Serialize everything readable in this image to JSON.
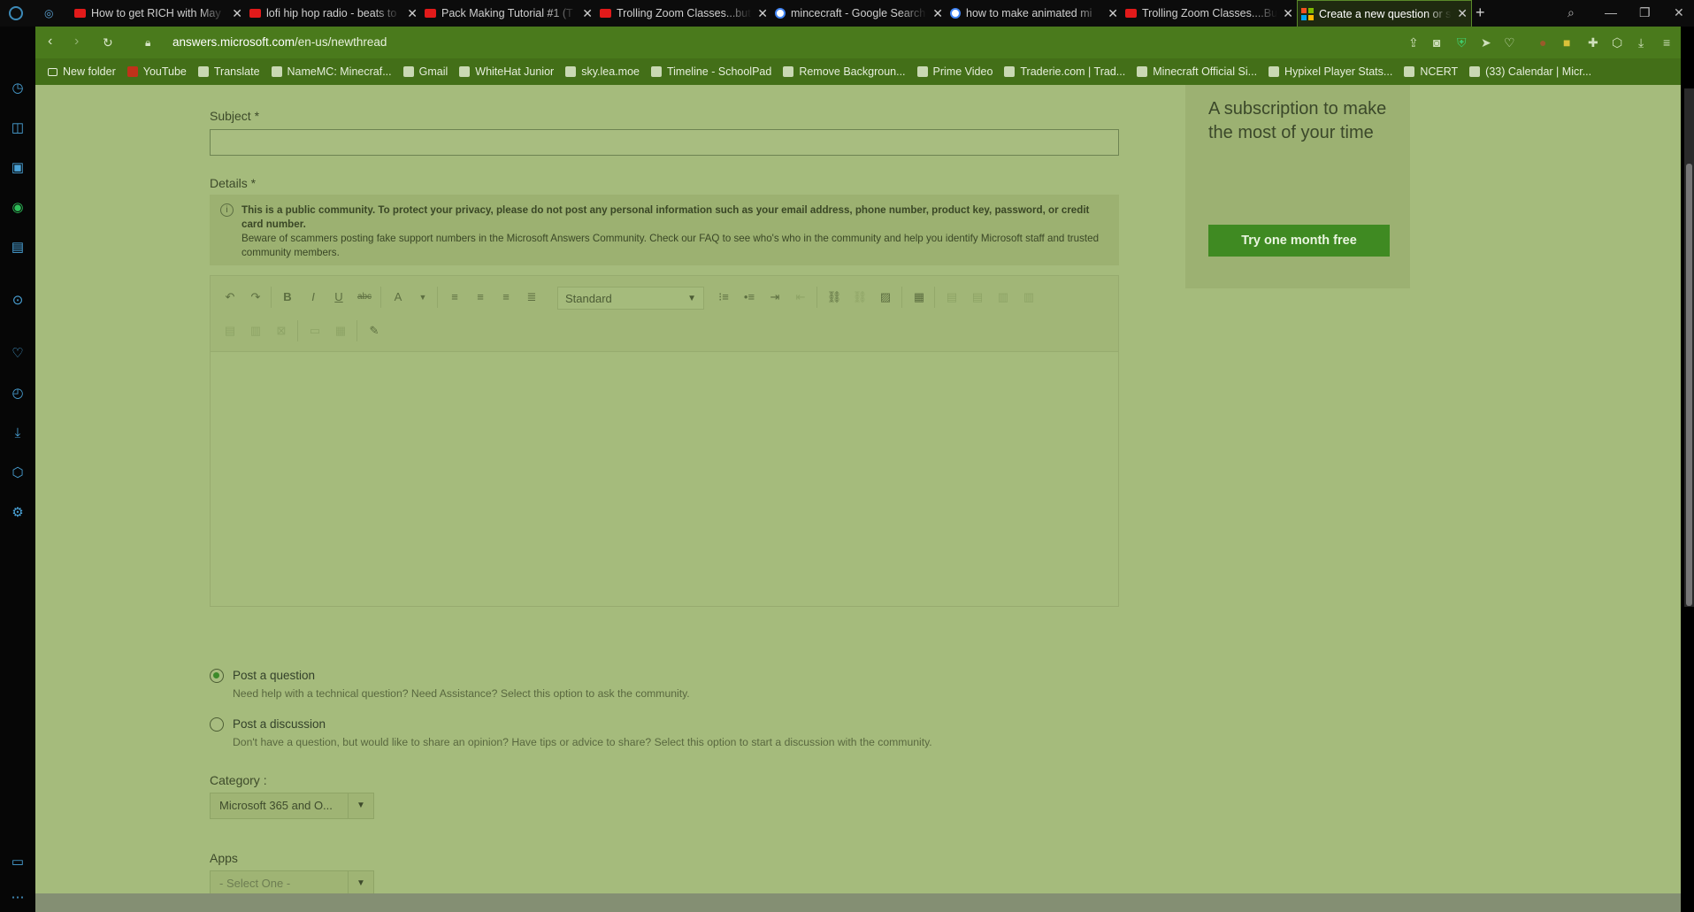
{
  "tabs": [
    {
      "title": "How to get RICH with May",
      "icon": "youtube-icon"
    },
    {
      "title": "lofi hip hop radio - beats to",
      "icon": "youtube-icon"
    },
    {
      "title": "Pack Making Tutorial #1 (T",
      "icon": "youtube-icon"
    },
    {
      "title": "Trolling Zoom Classes...but",
      "icon": "youtube-icon"
    },
    {
      "title": "mincecraft - Google Search",
      "icon": "google-icon"
    },
    {
      "title": "how to make animated mi",
      "icon": "google-icon"
    },
    {
      "title": "Trolling Zoom Classes....Bu",
      "icon": "youtube-icon"
    },
    {
      "title": "Create a new question or st",
      "icon": "microsoft-icon",
      "active": true
    }
  ],
  "address": {
    "host": "answers.microsoft.com",
    "path": "/en-us/newthread"
  },
  "bookmarks": [
    "New folder",
    "YouTube",
    "Translate",
    "NameMC: Minecraf...",
    "Gmail",
    "WhiteHat Junior",
    "sky.lea.moe",
    "Timeline - SchoolPad",
    "Remove Backgroun...",
    "Prime Video",
    "Traderie.com | Trad...",
    "Minecraft Official Si...",
    "Hypixel Player Stats...",
    "NCERT",
    "(33) Calendar | Micr..."
  ],
  "form": {
    "subject_label": "Subject *",
    "details_label": "Details *",
    "notice_line1": "This is a public community. To protect your privacy, please do not post any personal information such as your email address, phone number, product key, password, or credit card number.",
    "notice_line2": "Beware of scammers posting fake support numbers in the Microsoft Answers Community.  Check our FAQ to see who's who in the community and help you identify Microsoft staff and trusted community members.",
    "format_value": "Standard",
    "option_question_title": "Post a question",
    "option_question_desc": "Need help with a technical question? Need Assistance? Select this option to ask the community.",
    "option_discussion_title": "Post a discussion",
    "option_discussion_desc": "Don't have a question, but would like to share an opinion? Have tips or advice to share? Select this option to start a discussion with the community.",
    "category_label": "Category :",
    "category_value": "Microsoft 365 and O...",
    "apps_label": "Apps",
    "apps_value": "- Select One -"
  },
  "promo": {
    "text": "A subscription to make the most of your time",
    "button": "Try one month free"
  },
  "colors": {
    "accent": "#3f8a22",
    "overlay": "#a5bb7c"
  }
}
